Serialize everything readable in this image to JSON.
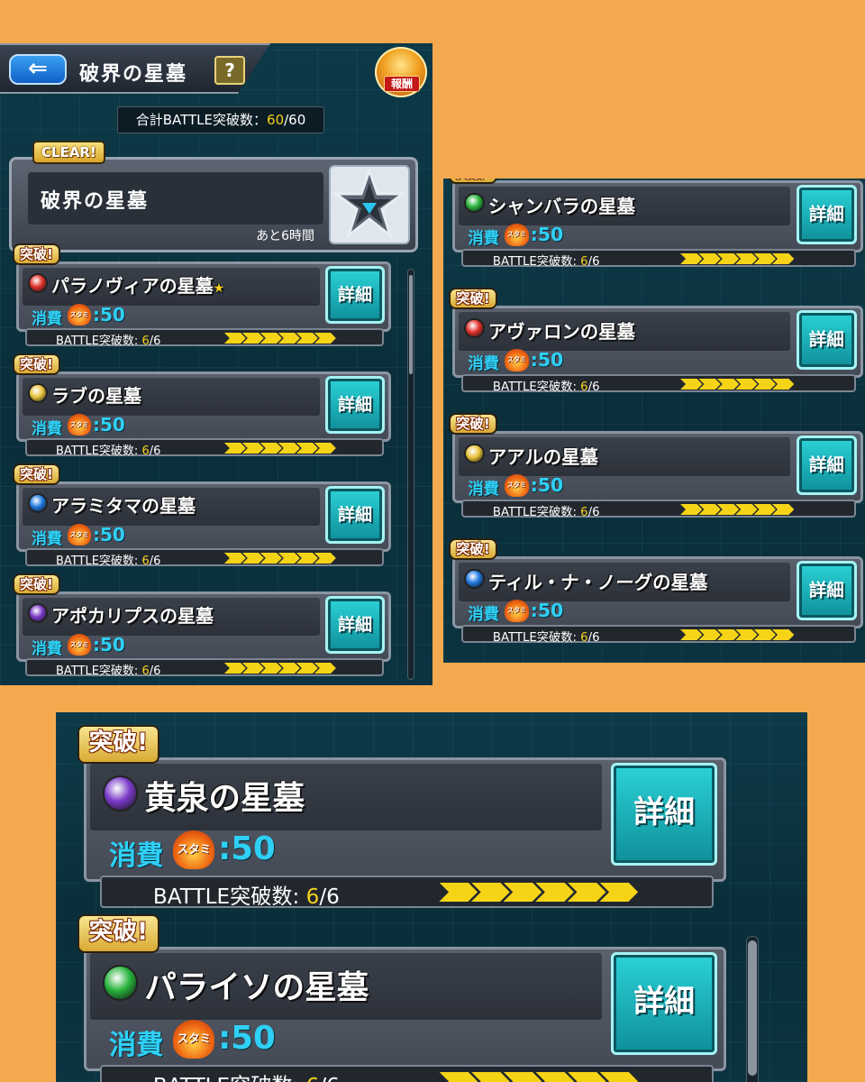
{
  "header": {
    "back_label": "⇐",
    "title": "破界の星墓",
    "help_label": "?",
    "reward_label": "報酬",
    "total_label": "合計BATTLE突破数：",
    "total_value": "60",
    "total_max": "/60"
  },
  "cleared_card": {
    "tag": "CLEAR!",
    "title": "破界の星墓",
    "time_left": "あと6時間"
  },
  "common": {
    "tag": "突破!",
    "cost_label": "消費",
    "stamina_label": "スタミナ",
    "cost_value": ":50",
    "battle_label": "BATTLE突破数:",
    "battle_done": "6",
    "battle_total": "/6",
    "detail_label": "詳細"
  },
  "stages_a": [
    {
      "name": "パラノヴィアの星墓",
      "star": "★",
      "icon": "fire-element-icon",
      "progress": 1.0
    },
    {
      "name": "ラブの星墓",
      "icon": "light-element-icon",
      "progress": 1.0
    },
    {
      "name": "アラミタマの星墓",
      "icon": "water-element-icon",
      "progress": 1.0
    },
    {
      "name": "アポカリプスの星墓",
      "icon": "dark-element-icon",
      "progress": 1.0
    }
  ],
  "stages_b": [
    {
      "name": "シャンバラの星墓",
      "icon": "wood-element-icon",
      "progress": 1.0
    },
    {
      "name": "アヴァロンの星墓",
      "icon": "fire-element-icon",
      "progress": 1.0
    },
    {
      "name": "アアルの星墓",
      "icon": "light-element-icon",
      "progress": 1.0
    },
    {
      "name": "ティル・ナ・ノーグの星墓",
      "icon": "water-element-icon",
      "progress": 1.0
    }
  ],
  "stages_c": [
    {
      "name": "黄泉の星墓",
      "icon": "dark-element-icon",
      "progress": 1.0
    },
    {
      "name": "パライソの星墓",
      "icon": "wood-element-icon",
      "progress": 1.0
    }
  ],
  "element_colors": {
    "fire": "#e0302a",
    "water": "#1e78e0",
    "wood": "#28b43c",
    "light": "#e8c23a",
    "dark": "#7a3ac8"
  }
}
